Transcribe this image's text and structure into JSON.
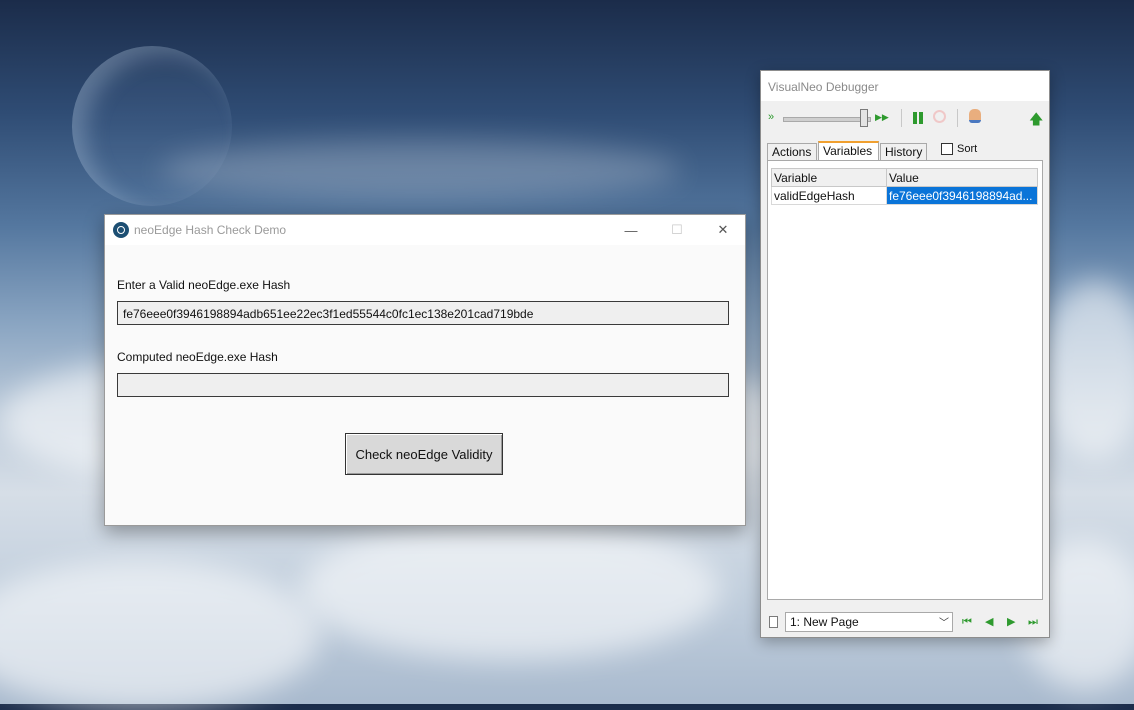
{
  "app_window": {
    "title": "neoEdge Hash Check Demo",
    "controls": {
      "minimize": "—",
      "maximize": "☐",
      "close": "✕"
    },
    "valid_hash_label": "Enter a Valid neoEdge.exe Hash",
    "valid_hash_value": "fe76eee0f3946198894adb651ee22ec3f1ed55544c0fc1ec138e201cad719bde",
    "computed_hash_label": "Computed neoEdge.exe Hash",
    "computed_hash_value": "",
    "check_button_label": "Check neoEdge Validity"
  },
  "debugger": {
    "title": "VisualNeo Debugger",
    "toolbar": {
      "slow_icon": "step-slow-icon",
      "fast_icon": "step-fast-icon",
      "pause_icon": "pause-icon",
      "stop_icon": "stop-icon",
      "inspect_icon": "hand-icon",
      "up_icon": "up-arrow-icon",
      "slow_glyph": "»",
      "fast_glyph": "▶▶",
      "up_glyph": "🡅"
    },
    "tabs": [
      "Actions",
      "Variables",
      "History"
    ],
    "active_tab": "Variables",
    "sort_label": "Sort",
    "sort_checked": false,
    "columns": [
      "Variable",
      "Value"
    ],
    "rows": [
      {
        "variable": "validEdgeHash",
        "value": "fe76eee0f3946198894ad..."
      }
    ],
    "page_select": "1: New Page",
    "nav": {
      "first": "⏮",
      "prev": "◀",
      "next": "▶",
      "last": "⏭"
    }
  },
  "colors": {
    "accent_selection": "#0a74d8",
    "tab_accent": "#f0a030",
    "toolbar_green": "#2e9a2e"
  }
}
